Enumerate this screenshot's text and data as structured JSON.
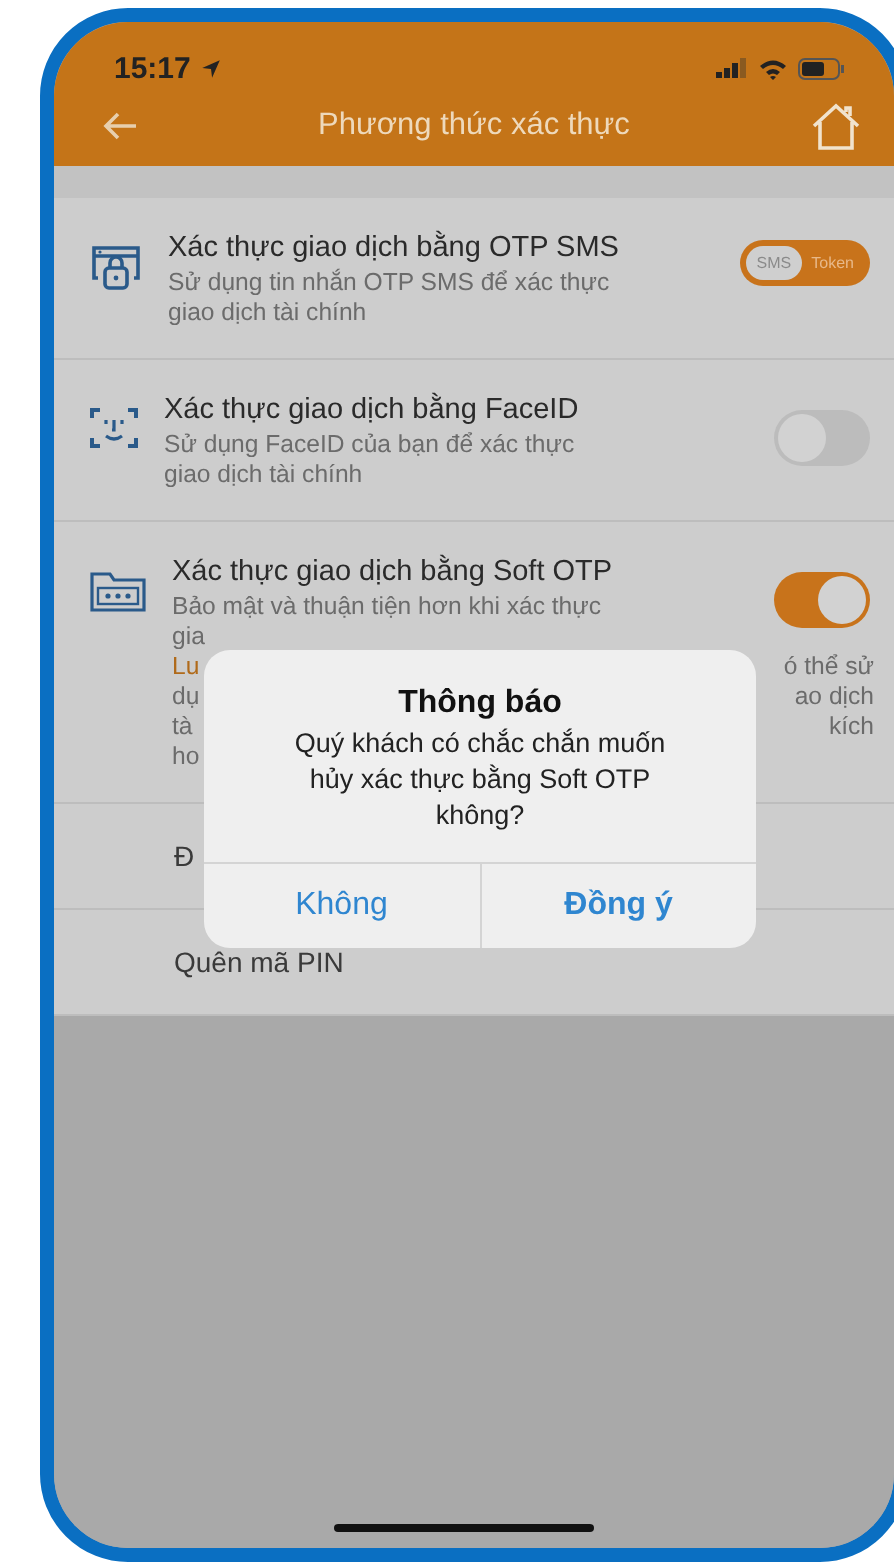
{
  "status_bar": {
    "time": "15:17"
  },
  "header": {
    "title": "Phương thức xác thực"
  },
  "methods": [
    {
      "kind": "segmented",
      "title": "Xác thực giao dịch bằng OTP SMS",
      "description": [
        "Sử dụng tin nhắn OTP SMS để xác thực",
        "giao dịch tài chính"
      ],
      "segments": [
        {
          "label": "SMS",
          "selected": true
        },
        {
          "label": "Token",
          "selected": false
        }
      ]
    },
    {
      "kind": "switch",
      "title": "Xác thực giao dịch bằng FaceID",
      "description": [
        "Sử dụng FaceID của bạn để xác thực",
        "giao dịch tài chính"
      ],
      "on": false
    },
    {
      "kind": "switch",
      "title": "Xác thực giao dịch bằng Soft OTP",
      "description": [
        "Bảo mật và thuận tiện hơn khi xác thực",
        "gia"
      ],
      "on": true,
      "note_lines": [
        {
          "left": "Lu",
          "right": "ó thể sử",
          "warn": true
        },
        {
          "left": "dụ",
          "right": "ao dịch",
          "warn": false
        },
        {
          "left": "tà",
          "right": "kích",
          "warn": false
        },
        {
          "left": "ho",
          "warn": false
        }
      ]
    }
  ],
  "menu_items": [
    "Đ",
    "Quên mã PIN"
  ],
  "dialog": {
    "title": "Thông báo",
    "message": "Quý khách có chắc chắn muốn hủy xác thực bằng Soft OTP không?",
    "buttons": [
      {
        "label": "Không",
        "kind": "cancel"
      },
      {
        "label": "Đồng ý",
        "kind": "confirm"
      }
    ]
  }
}
